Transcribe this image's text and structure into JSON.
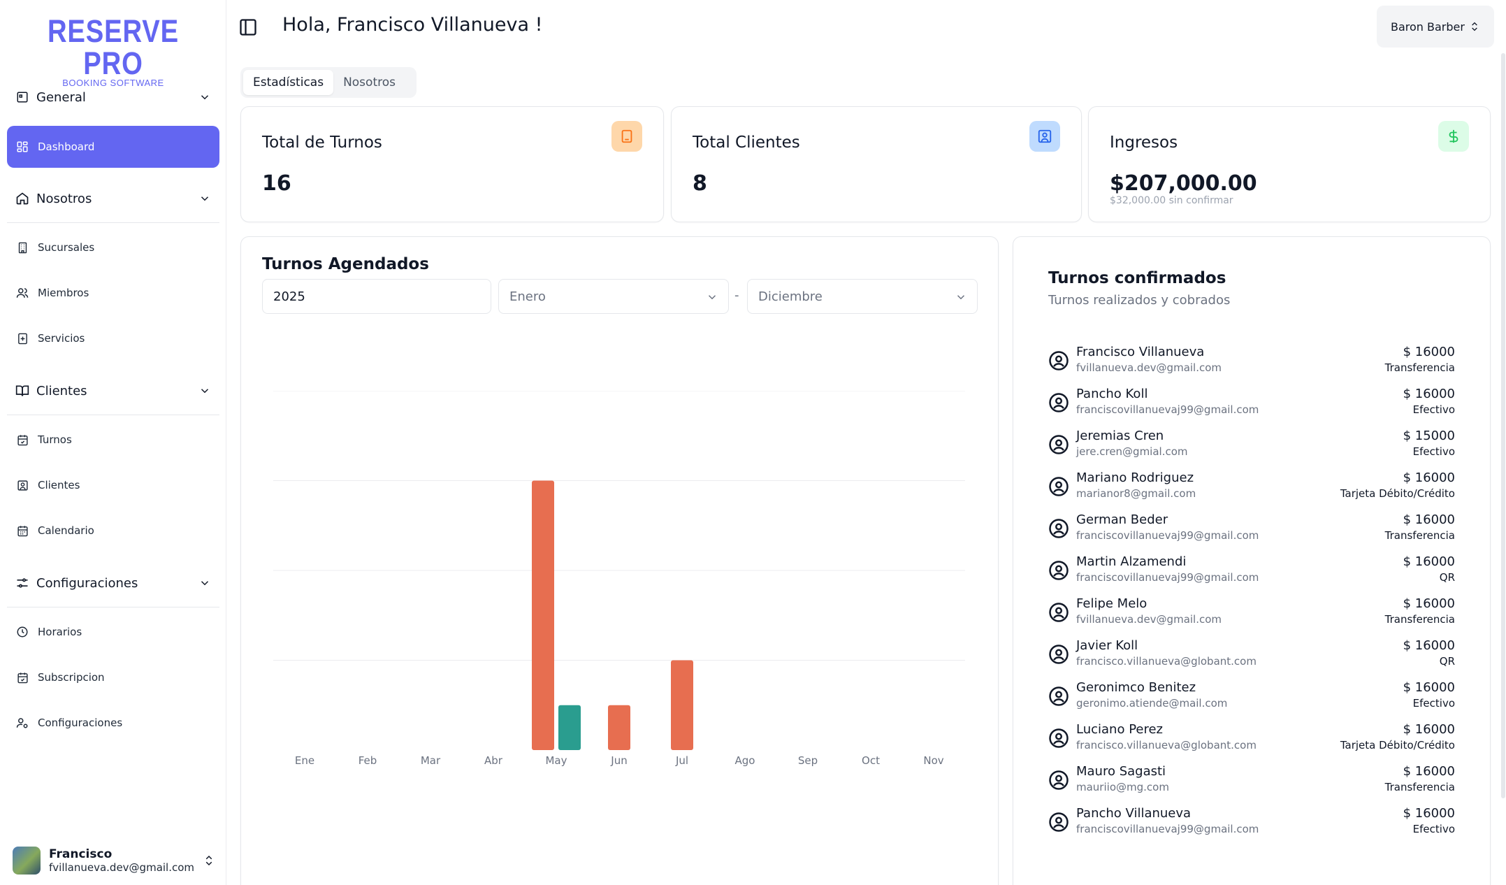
{
  "app": {
    "logo_main": "RESERVE PRO",
    "logo_sub": "BOOKING SOFTWARE"
  },
  "sidebar": {
    "groups": [
      {
        "label": "General",
        "icon": "layout-icon"
      },
      {
        "label": "Nosotros",
        "icon": "home-icon"
      },
      {
        "label": "Clientes",
        "icon": "book-open-icon"
      },
      {
        "label": "Configuraciones",
        "icon": "sliders-icon"
      }
    ],
    "items": [
      {
        "label": "Dashboard",
        "active": true
      },
      {
        "label": "Sucursales"
      },
      {
        "label": "Miembros"
      },
      {
        "label": "Servicios"
      },
      {
        "label": "Turnos"
      },
      {
        "label": "Clientes"
      },
      {
        "label": "Calendario"
      },
      {
        "label": "Horarios"
      },
      {
        "label": "Subscripcion"
      },
      {
        "label": "Configuraciones"
      }
    ],
    "user": {
      "name": "Francisco",
      "email": "fvillanueva.dev@gmail.com"
    }
  },
  "header": {
    "greeting": "Hola, Francisco Villanueva !",
    "store": "Baron Barber"
  },
  "tabs": [
    {
      "label": "Estadísticas",
      "active": true
    },
    {
      "label": "Nosotros"
    }
  ],
  "stats": {
    "turnos": {
      "title": "Total de Turnos",
      "value": "16"
    },
    "clientes": {
      "title": "Total Clientes",
      "value": "8"
    },
    "ingresos": {
      "title": "Ingresos",
      "value": "$207,000.00",
      "sub": "$32,000.00 sin confirmar"
    }
  },
  "colors": {
    "accent": "#6366f1",
    "bar_primary": "#e76e50",
    "bar_secondary": "#2a9d8f",
    "orange_icon_bg": "#fed7aa",
    "blue_icon_bg": "#bfdbfe",
    "green_icon_bg": "#dcfce7"
  },
  "turnos_agendados": {
    "title": "Turnos Agendados",
    "year": "2025",
    "from_month": "Enero",
    "to_month": "Diciembre",
    "separator": "-"
  },
  "chart_data": {
    "type": "bar",
    "categories": [
      "Ene",
      "Feb",
      "Mar",
      "Abr",
      "May",
      "Jun",
      "Jul",
      "Ago",
      "Sep",
      "Oct",
      "Nov"
    ],
    "series": [
      {
        "values": [
          0,
          0,
          0,
          0,
          6,
          1,
          2,
          0,
          0,
          0,
          0
        ],
        "color": "#e76e50"
      },
      {
        "values": [
          0,
          0,
          0,
          0,
          1,
          0,
          0,
          0,
          0,
          0,
          0
        ],
        "color": "#2a9d8f"
      }
    ],
    "ylim": [
      0,
      8
    ],
    "grid": true,
    "title": "",
    "xlabel": "",
    "ylabel": ""
  },
  "confirmados": {
    "title": "Turnos confirmados",
    "subtitle": "Turnos realizados y cobrados",
    "rows": [
      {
        "name": "Francisco Villanueva",
        "email": "fvillanueva.dev@gmail.com",
        "amount": "$ 16000",
        "method": "Transferencia"
      },
      {
        "name": "Pancho Koll",
        "email": "franciscovillanuevaj99@gmail.com",
        "amount": "$ 16000",
        "method": "Efectivo"
      },
      {
        "name": "Jeremias Cren",
        "email": "jere.cren@gmial.com",
        "amount": "$ 15000",
        "method": "Efectivo"
      },
      {
        "name": "Mariano Rodriguez",
        "email": "marianor8@gmail.com",
        "amount": "$ 16000",
        "method": "Tarjeta Débito/Crédito"
      },
      {
        "name": "German Beder",
        "email": "franciscovillanuevaj99@gmail.com",
        "amount": "$ 16000",
        "method": "Transferencia"
      },
      {
        "name": "Martin Alzamendi",
        "email": "franciscovillanuevaj99@gmail.com",
        "amount": "$ 16000",
        "method": "QR"
      },
      {
        "name": "Felipe Melo",
        "email": "fvillanueva.dev@gmail.com",
        "amount": "$ 16000",
        "method": "Transferencia"
      },
      {
        "name": "Javier Koll",
        "email": "francisco.villanueva@globant.com",
        "amount": "$ 16000",
        "method": "QR"
      },
      {
        "name": "Geronimco Benitez",
        "email": "geronimo.atiende@mail.com",
        "amount": "$ 16000",
        "method": "Efectivo"
      },
      {
        "name": "Luciano Perez",
        "email": "francisco.villanueva@globant.com",
        "amount": "$ 16000",
        "method": "Tarjeta Débito/Crédito"
      },
      {
        "name": "Mauro Sagasti",
        "email": "mauriio@mg.com",
        "amount": "$ 16000",
        "method": "Transferencia"
      },
      {
        "name": "Pancho Villanueva",
        "email": "franciscovillanuevaj99@gmail.com",
        "amount": "$ 16000",
        "method": "Efectivo"
      }
    ]
  }
}
